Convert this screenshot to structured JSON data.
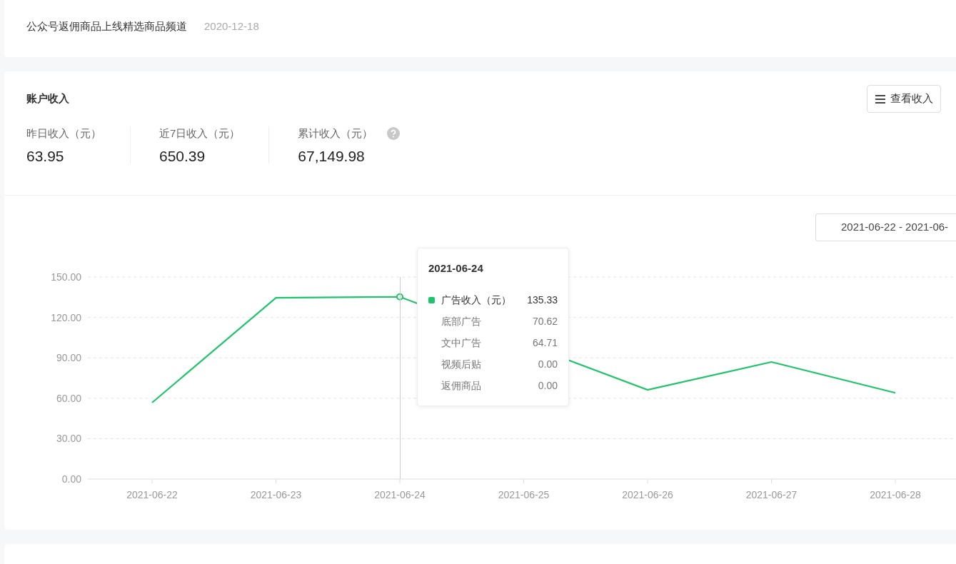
{
  "notices": [
    {
      "title": "公众号返佣商品上线精选商品频道",
      "date": "2020-12-18"
    }
  ],
  "income": {
    "title": "账户收入",
    "view_button": "查看收入",
    "stats": [
      {
        "label": "昨日收入（元）",
        "value": "63.95",
        "help": false
      },
      {
        "label": "近7日收入（元）",
        "value": "650.39",
        "help": false
      },
      {
        "label": "累计收入（元）",
        "value": "67,149.98",
        "help": true
      }
    ],
    "date_range": "2021-06-22 - 2021-06-",
    "chart_data": {
      "type": "line",
      "grid": true,
      "categories": [
        "2021-06-22",
        "2021-06-23",
        "2021-06-24",
        "2021-06-25",
        "2021-06-26",
        "2021-06-27",
        "2021-06-28"
      ],
      "series": [
        {
          "name": "广告收入（元）",
          "color": "#1fc46a",
          "values": [
            56.7,
            134.6,
            135.3,
            null,
            66.2,
            86.9,
            64
          ]
        }
      ],
      "ylim": [
        0,
        150
      ],
      "yticks": [
        {
          "value": 0,
          "label": "0.00"
        },
        {
          "value": 30,
          "label": "30.00"
        },
        {
          "value": 60,
          "label": "60.00"
        },
        {
          "value": 90,
          "label": "90.00"
        },
        {
          "value": 120,
          "label": "120.00"
        },
        {
          "value": 150,
          "label": "150.00"
        }
      ]
    },
    "tooltip": {
      "title": "2021-06-24",
      "series_value": "135.33",
      "breakdown": [
        {
          "label": "底部广告",
          "value": "70.62"
        },
        {
          "label": "文中广告",
          "value": "64.71"
        },
        {
          "label": "视频后贴",
          "value": "0.00"
        },
        {
          "label": "返佣商品",
          "value": "0.00"
        }
      ]
    }
  }
}
